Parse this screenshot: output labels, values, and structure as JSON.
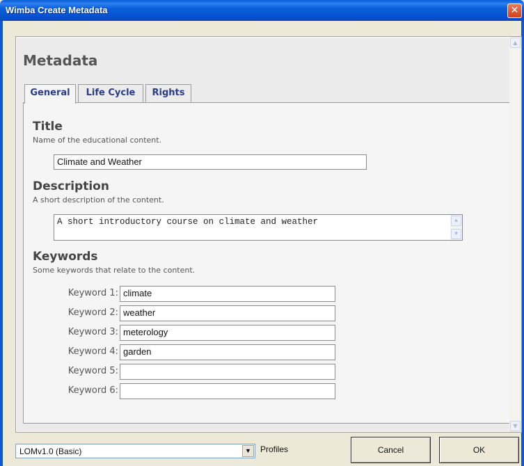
{
  "window": {
    "title": "Wimba Create Metadata",
    "close_glyph": "✕"
  },
  "page": {
    "heading": "Metadata"
  },
  "tabs": [
    {
      "label": "General",
      "active": true
    },
    {
      "label": "Life Cycle",
      "active": false
    },
    {
      "label": "Rights",
      "active": false
    }
  ],
  "general": {
    "title": {
      "heading": "Title",
      "description": "Name of the educational content.",
      "value": "Climate and Weather"
    },
    "description": {
      "heading": "Description",
      "description": "A short description of the content.",
      "value": "A short introductory course on climate and weather"
    },
    "keywords": {
      "heading": "Keywords",
      "description": "Some keywords that relate to the content.",
      "items": [
        {
          "label": "Keyword 1:",
          "value": "climate"
        },
        {
          "label": "Keyword 2:",
          "value": "weather"
        },
        {
          "label": "Keyword 3:",
          "value": "meterology"
        },
        {
          "label": "Keyword 4:",
          "value": "garden"
        },
        {
          "label": "Keyword 5:",
          "value": ""
        },
        {
          "label": "Keyword 6:",
          "value": ""
        }
      ]
    }
  },
  "footer": {
    "profile_select_value": "LOMv1.0 (Basic)",
    "profiles_label": "Profiles",
    "cancel_label": "Cancel",
    "ok_label": "OK"
  },
  "icons": {
    "scroll_up": "▲",
    "scroll_down": "▼",
    "dropdown": "▼"
  },
  "colors": {
    "titlebar": "#0b5fd9",
    "tab_text": "#2a3a8c",
    "close_button": "#d4401c"
  }
}
